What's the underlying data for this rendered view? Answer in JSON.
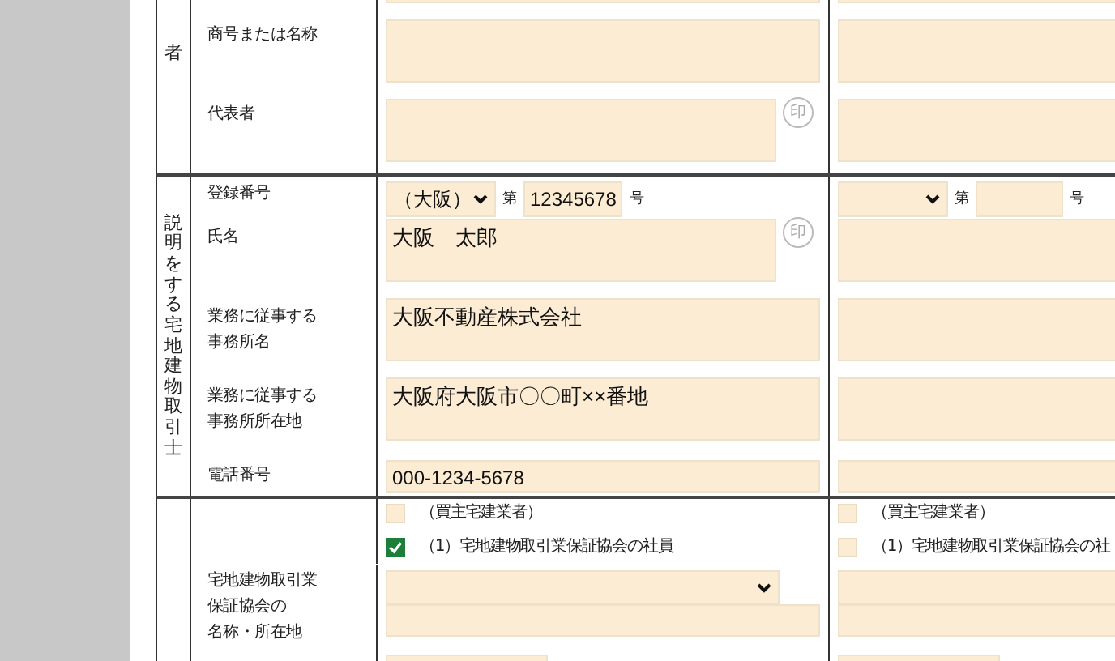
{
  "sections": [
    {
      "group": "者",
      "rows": [
        {
          "kind": "textarea",
          "cells": [
            {},
            {}
          ]
        },
        {
          "kind": "textarea",
          "label": "商号または名称",
          "cells": [
            {},
            {}
          ]
        },
        {
          "kind": "textarea",
          "label": "代表者",
          "cells": [
            {
              "stamp": "印"
            },
            {}
          ]
        }
      ]
    },
    {
      "group": "説明をする宅地建物取引士",
      "rows": [
        {
          "kind": "register",
          "label": "登録番号",
          "cells": [
            {
              "region": "（大阪）",
              "prefix": "第",
              "value": "12345678",
              "suffix": "号"
            },
            {
              "prefix": "第",
              "suffix": "号"
            }
          ]
        },
        {
          "kind": "textarea",
          "label": "氏名",
          "cells": [
            {
              "value": "大阪　太郎",
              "stamp": "印"
            },
            {}
          ]
        },
        {
          "kind": "textarea",
          "label": [
            "業務に従事する",
            "事務所名"
          ],
          "cells": [
            {
              "value": "大阪不動産株式会社"
            },
            {}
          ]
        },
        {
          "kind": "textarea",
          "label": [
            "業務に従事する",
            "事務所所在地"
          ],
          "cells": [
            {
              "value": "大阪府大阪市〇〇町××番地"
            },
            {}
          ]
        },
        {
          "kind": "line",
          "label": "電話番号",
          "cells": [
            {
              "value": "000-1234-5678"
            },
            {}
          ]
        }
      ]
    },
    {
      "rows": [
        {
          "kind": "check",
          "cells": [
            {
              "checked": false,
              "label": "（買主宅建業者）"
            },
            {
              "checked": false,
              "label": "（買主宅建業者）"
            }
          ]
        },
        {
          "kind": "check",
          "cells": [
            {
              "checked": true,
              "label": "（1）宅地建物取引業保証協会の社員"
            },
            {
              "checked": false,
              "label": "（1）宅地建物取引業保証協会の社"
            }
          ]
        },
        {
          "kind": "combo",
          "label": [
            "宅地建物取引業",
            "保証協会の",
            "名称・所在地"
          ],
          "cells": [
            {
              "arrow": true
            },
            {}
          ]
        },
        {
          "kind": "short",
          "cells": [
            {},
            {}
          ]
        }
      ]
    }
  ]
}
